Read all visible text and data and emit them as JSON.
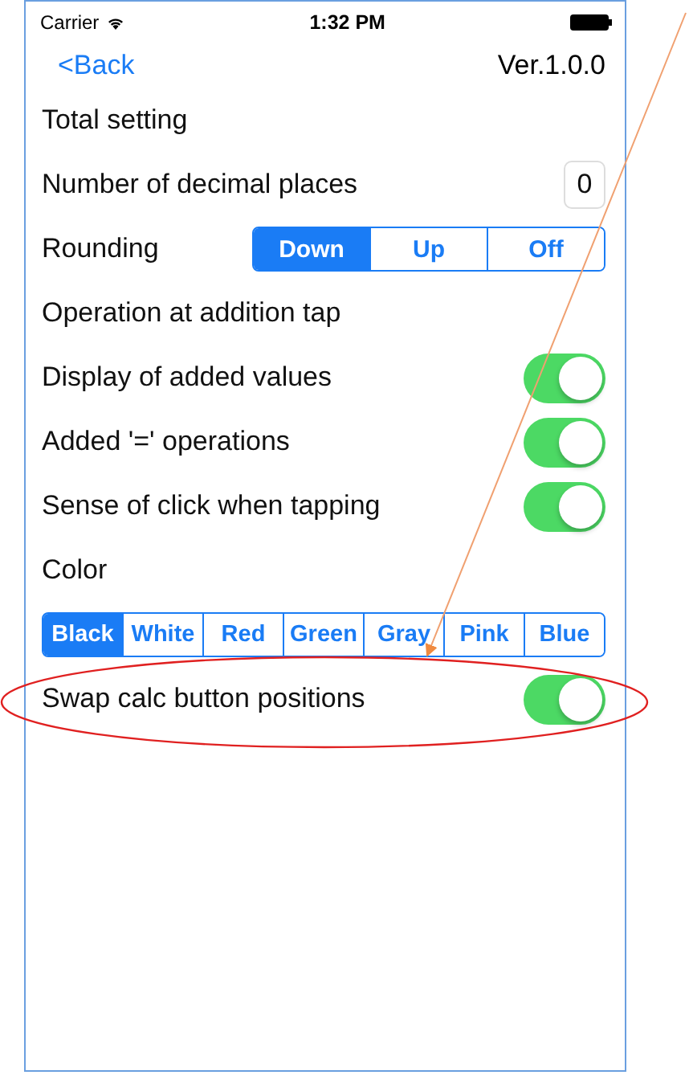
{
  "status_bar": {
    "carrier": "Carrier",
    "time": "1:32 PM"
  },
  "nav": {
    "back": "<Back",
    "version": "Ver.1.0.0"
  },
  "rows": [
    {
      "kind": "header",
      "label": "Total setting"
    },
    {
      "kind": "number",
      "label": "Number of decimal places",
      "value": "0"
    },
    {
      "kind": "segmented",
      "label": "Rounding",
      "options": [
        {
          "label": "Down",
          "selected": true
        },
        {
          "label": "Up",
          "selected": false
        },
        {
          "label": "Off",
          "selected": false
        }
      ]
    },
    {
      "kind": "header",
      "label": "Operation at addition tap"
    },
    {
      "kind": "toggle",
      "label": "Display of added values",
      "on": true
    },
    {
      "kind": "toggle",
      "label": "Added '=' operations",
      "on": true
    },
    {
      "kind": "toggle",
      "label": "Sense of click when tapping",
      "on": true
    },
    {
      "kind": "header",
      "label": "Color"
    },
    {
      "kind": "wide-segmented",
      "options": [
        {
          "label": "Black",
          "selected": true
        },
        {
          "label": "White",
          "selected": false
        },
        {
          "label": "Red",
          "selected": false
        },
        {
          "label": "Green",
          "selected": false
        },
        {
          "label": "Gray",
          "selected": false
        },
        {
          "label": "Pink",
          "selected": false
        },
        {
          "label": "Blue",
          "selected": false
        }
      ]
    },
    {
      "kind": "toggle",
      "label": "Swap calc button positions",
      "on": true
    }
  ]
}
